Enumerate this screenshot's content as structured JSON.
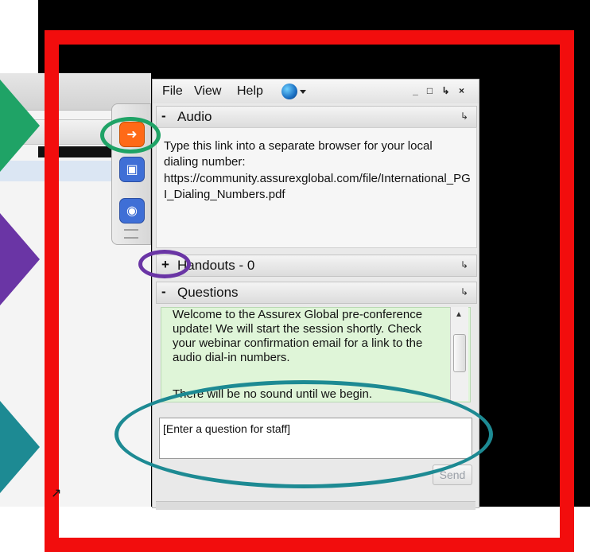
{
  "menubar": {
    "file": "File",
    "view": "View",
    "help": "Help"
  },
  "window_buttons": {
    "minimize": "_",
    "restore": "□",
    "popout": "↳",
    "close": "×"
  },
  "sections": {
    "audio": {
      "toggle": "-",
      "title": "Audio"
    },
    "handouts": {
      "toggle": "+",
      "title": "Handouts - 0"
    },
    "questions": {
      "toggle": "-",
      "title": "Questions"
    }
  },
  "audio": {
    "instructions": "Type this link into a separate browser for your local dialing number:",
    "url": "https://community.assurexglobal.com/file/International_PGI_Dialing_Numbers.pdf"
  },
  "questions": {
    "messages": [
      "Welcome to the Assurex Global pre-conference update! We will start the session shortly. Check your webinar confirmation email for a link to the audio dial-in numbers.",
      "There will be no sound until we begin."
    ],
    "input_placeholder": "[Enter a question for staff]",
    "send_label": "Send"
  },
  "toolbar_icons": [
    "exit-arrow-icon",
    "screen-icon",
    "person-icon"
  ],
  "colors": {
    "frame_red": "#f20d0d",
    "arrow_green": "#1fa366",
    "arrow_purple": "#6a35a5",
    "arrow_teal": "#1d8a93",
    "chat_green": "#dff5d8"
  }
}
